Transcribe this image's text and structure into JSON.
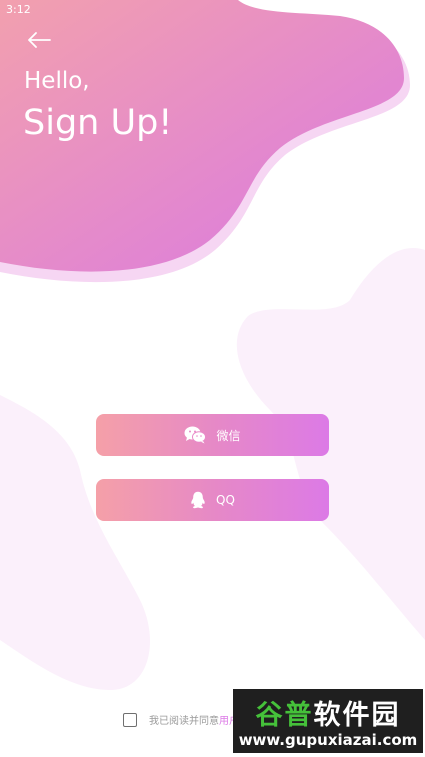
{
  "status_bar": {
    "time": "3:12",
    "icons": [
      "wifi-icon",
      "battery-icon"
    ]
  },
  "header": {
    "greeting": "Hello,",
    "title": "Sign Up!"
  },
  "buttons": {
    "wechat_label": "微信",
    "qq_label": "QQ"
  },
  "agreement": {
    "text": "我已阅读并同意",
    "link_text": "用户"
  },
  "watermark": {
    "brand_green": "谷普",
    "brand_white": "软件园",
    "url": "www.gupuxiazai.com"
  },
  "colors": {
    "gradient_start": "#f5a0a8",
    "gradient_end": "#dc7ae6",
    "accent": "#dc7ae6",
    "blob_light": "#fbeefa"
  }
}
